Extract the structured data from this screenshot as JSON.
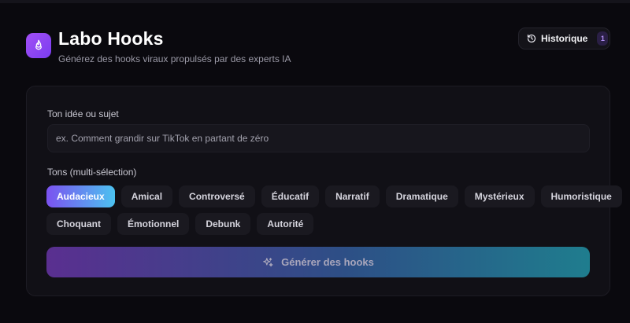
{
  "header": {
    "title": "Labo Hooks",
    "subtitle": "Générez des hooks viraux propulsés par des experts IA",
    "logo_icon": "flame-icon",
    "history": {
      "label": "Historique",
      "badge": "1",
      "icon": "history-icon"
    }
  },
  "form": {
    "idea": {
      "label": "Ton idée ou sujet",
      "placeholder": "ex. Comment grandir sur TikTok en partant de zéro",
      "value": ""
    },
    "tones": {
      "label": "Tons (multi-sélection)",
      "row1": [
        "Audacieux",
        "Amical",
        "Controversé",
        "Éducatif",
        "Narratif",
        "Dramatique",
        "Mystérieux",
        "Humoristique"
      ],
      "row2": [
        "Choquant",
        "Émotionnel",
        "Debunk",
        "Autorité"
      ],
      "selected": "Audacieux"
    },
    "generate": {
      "label": "Générer des hooks",
      "icon": "sparkles-icon"
    }
  },
  "colors": {
    "accent_start": "#7b52f0",
    "accent_end": "#4cc2f0",
    "logo": "#a24ff5",
    "background": "#0a090e"
  }
}
